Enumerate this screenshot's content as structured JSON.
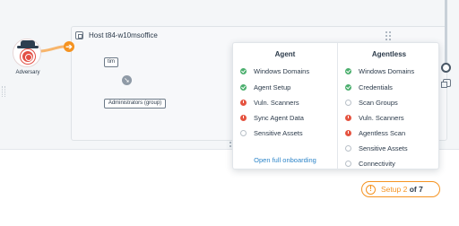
{
  "adversary": {
    "label": "Adversary",
    "icon": "adversary-icon"
  },
  "host": {
    "title": "Host t84-w10msoffice",
    "icon": "host-icon"
  },
  "nodes": {
    "user": "tim",
    "group": "Administrators (group)"
  },
  "popup": {
    "agent": {
      "title": "Agent",
      "items": [
        {
          "label": "Windows Domains",
          "status": "done"
        },
        {
          "label": "Agent Setup",
          "status": "done"
        },
        {
          "label": "Vuln. Scanners",
          "status": "error"
        },
        {
          "label": "Sync Agent Data",
          "status": "error"
        },
        {
          "label": "Sensitive Assets",
          "status": "pending"
        }
      ],
      "link": "Open full onboarding"
    },
    "agentless": {
      "title": "Agentless",
      "items": [
        {
          "label": "Windows Domains",
          "status": "done"
        },
        {
          "label": "Credentials",
          "status": "done"
        },
        {
          "label": "Scan Groups",
          "status": "pending"
        },
        {
          "label": "Vuln. Scanners",
          "status": "error"
        },
        {
          "label": "Agentless Scan",
          "status": "error"
        },
        {
          "label": "Sensitive Assets",
          "status": "pending"
        },
        {
          "label": "Connectivity",
          "status": "pending"
        }
      ]
    }
  },
  "setup": {
    "prefix": "Setup",
    "current": "2",
    "of": "of 7"
  },
  "colors": {
    "accent": "#f59321",
    "success": "#4caf6e",
    "error": "#e55340",
    "link": "#2f86c9"
  }
}
